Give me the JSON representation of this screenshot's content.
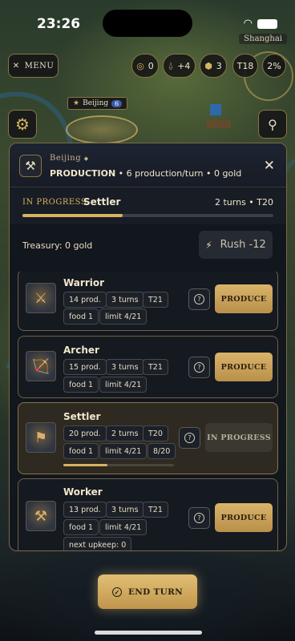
{
  "status_bar": {
    "time": "23:26"
  },
  "map": {
    "city_shanghai": "Shanghai",
    "city_beijing": "Beijing",
    "city_beijing_size": "6"
  },
  "hud": {
    "menu_label": "MENU",
    "science": "0",
    "culture": "+4",
    "production": "3",
    "turn": "T18",
    "percent": "2%"
  },
  "panel": {
    "city_name": "Beijing",
    "header_title": "PRODUCTION",
    "header_detail": " • 6 production/turn • 0 gold",
    "in_progress_label": "IN PROGRESS",
    "in_progress_unit": "Settler",
    "in_progress_turns": "2 turns • T20",
    "in_progress_fraction": 0.4,
    "treasury": "Treasury: 0 gold",
    "rush_label": "Rush -12"
  },
  "units": [
    {
      "name": "Warrior",
      "prod": "14 prod.",
      "turns": "3 turns",
      "ready": "T21",
      "food": "food 1",
      "limit": "limit 4/21",
      "action": "PRODUCE"
    },
    {
      "name": "Archer",
      "prod": "15 prod.",
      "turns": "3 turns",
      "ready": "T21",
      "food": "food 1",
      "limit": "limit 4/21",
      "action": "PRODUCE"
    },
    {
      "name": "Settler",
      "prod": "20 prod.",
      "turns": "2 turns",
      "ready": "T20",
      "food": "food 1",
      "limit": "limit 4/21",
      "progress": "8/20",
      "progress_fraction": 0.4,
      "action": "IN PROGRESS"
    },
    {
      "name": "Worker",
      "prod": "13 prod.",
      "turns": "3 turns",
      "ready": "T21",
      "food": "food 1",
      "limit": "limit 4/21",
      "upkeep": "next upkeep: 0",
      "action": "PRODUCE"
    }
  ],
  "footer": {
    "end_turn_label": "END TURN"
  },
  "colors": {
    "gold": "#d6b262",
    "panel": "#12161d",
    "border": "#7a6a48"
  }
}
